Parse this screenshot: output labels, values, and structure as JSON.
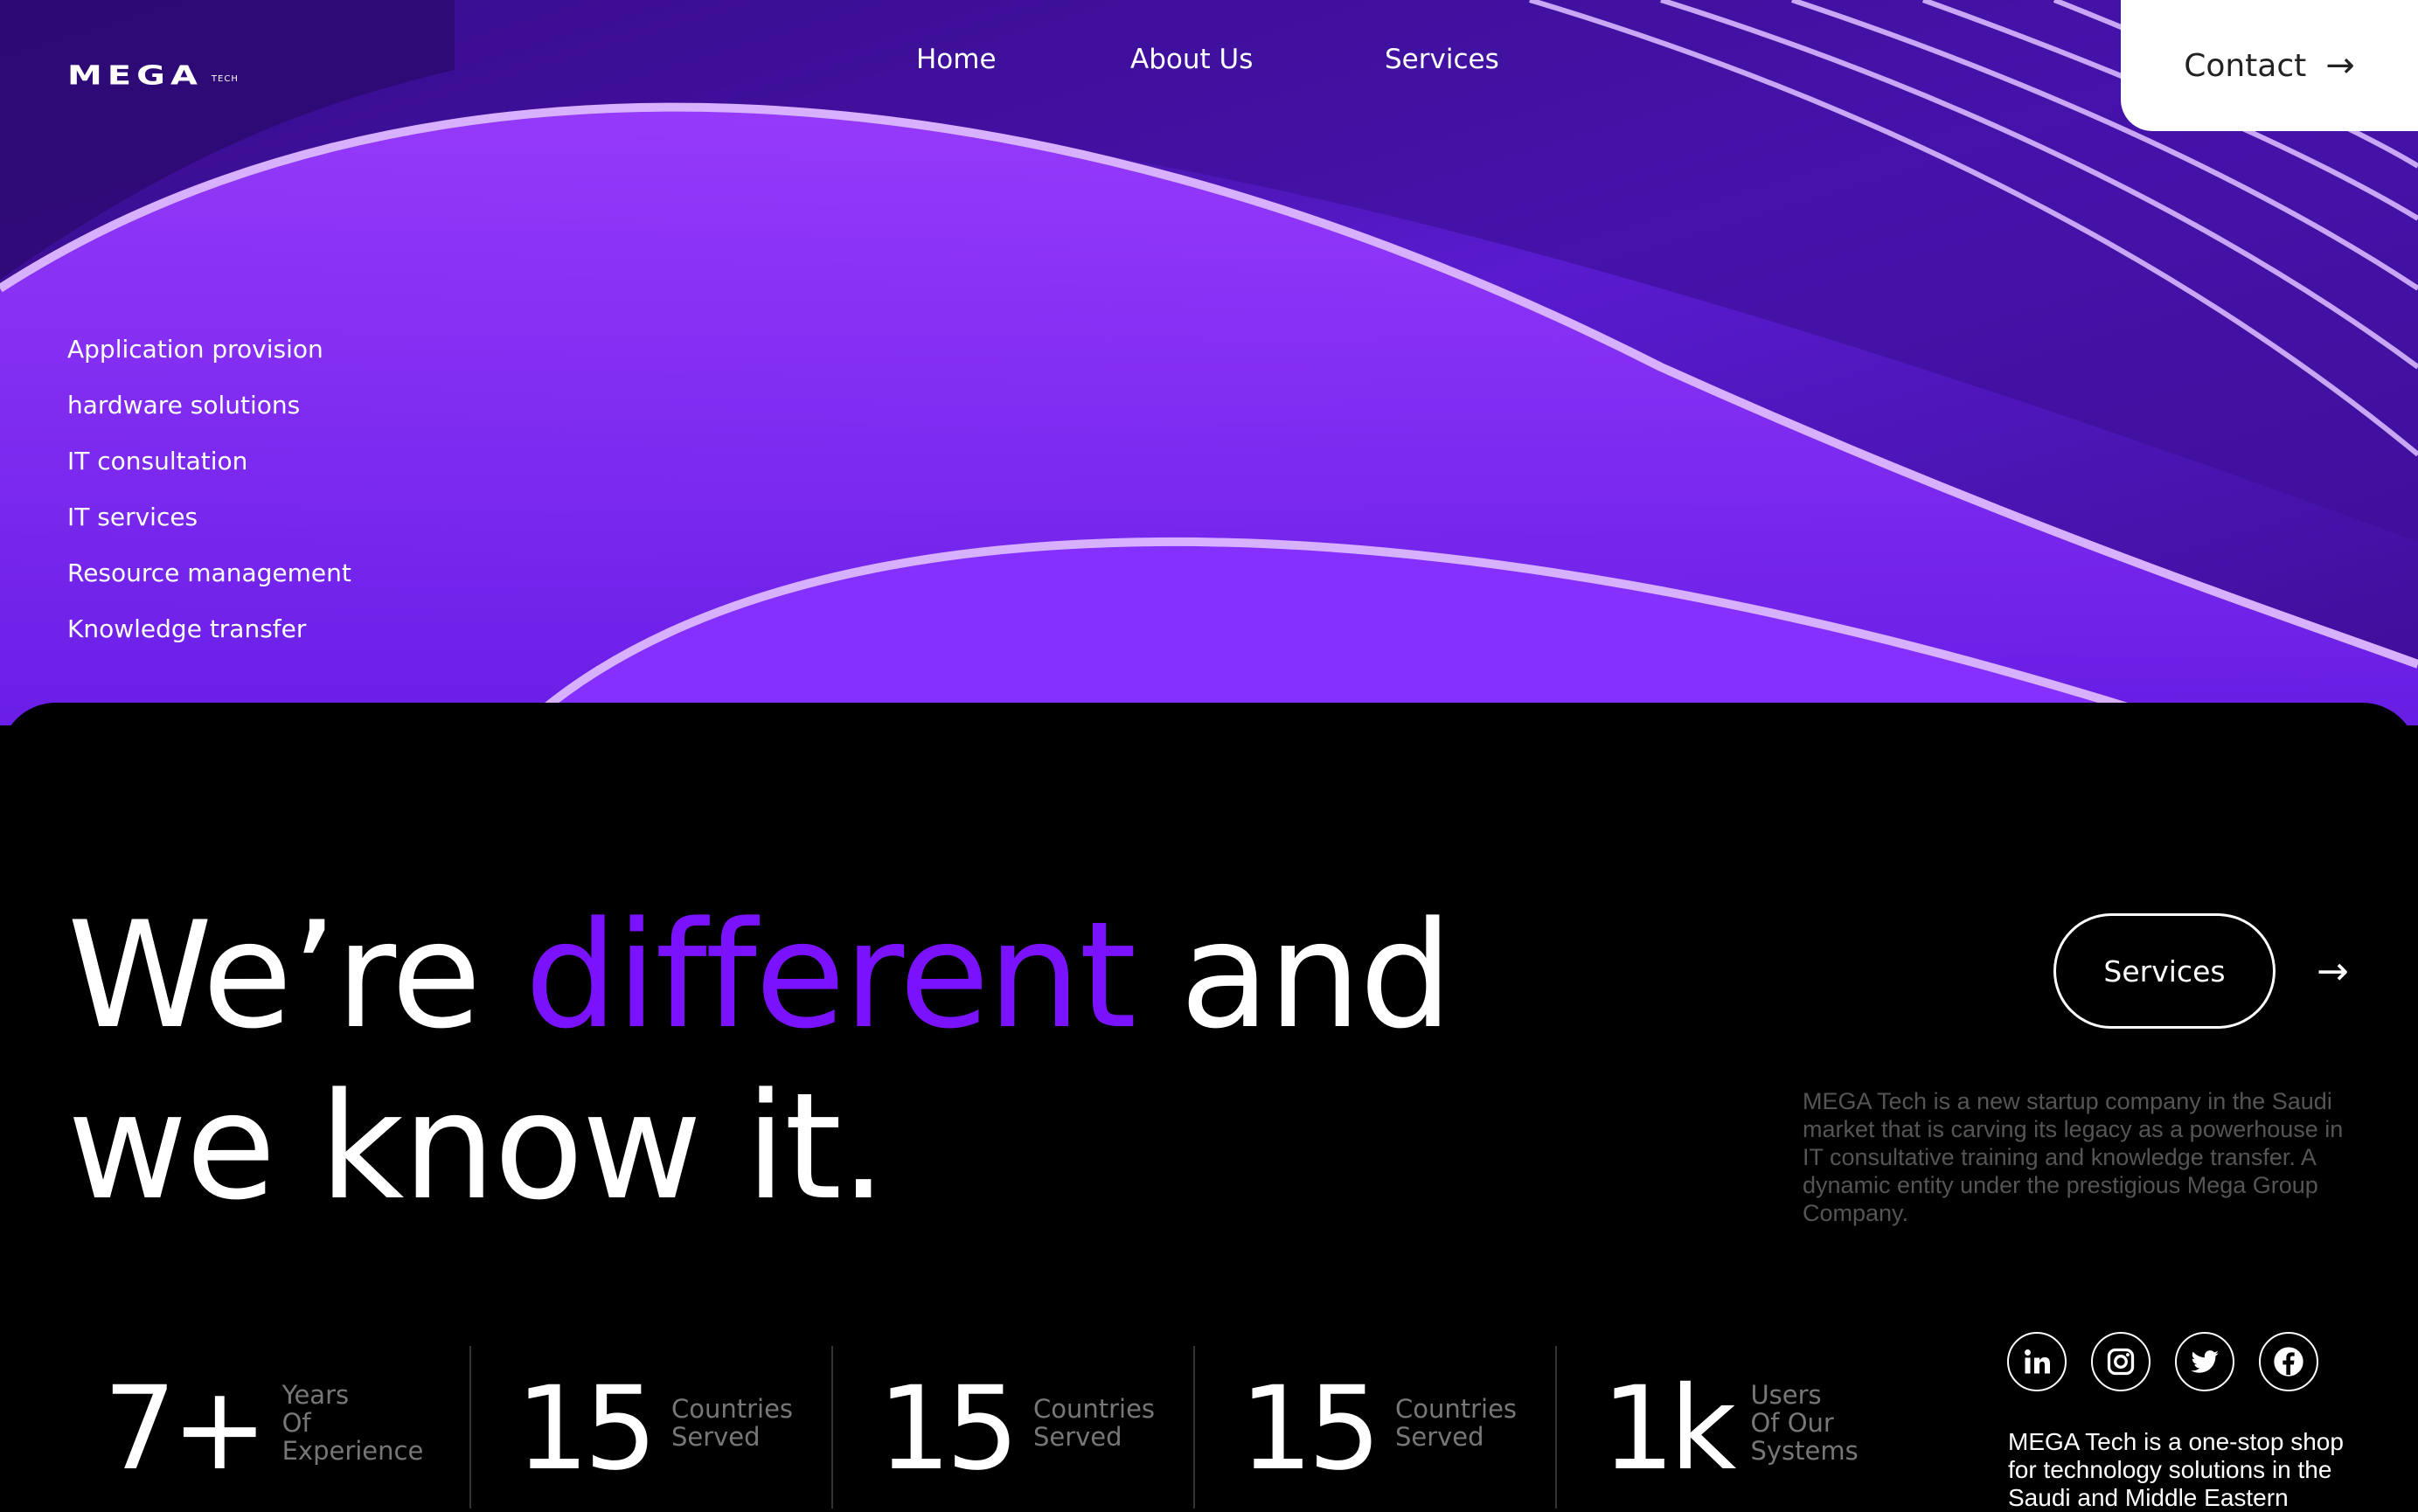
{
  "brand": {
    "name": "MEGA",
    "tag": "TECH"
  },
  "nav": {
    "home": "Home",
    "about": "About Us",
    "services": "Services"
  },
  "contact": {
    "label": "Contact",
    "arrow": "→"
  },
  "services_list": [
    "Application provision",
    "hardware solutions",
    "IT consultation",
    "IT services",
    "Resource management",
    "Knowledge transfer"
  ],
  "headline": {
    "part1": "We’re ",
    "accent": "different",
    "part2": " and",
    "line2": "we know it."
  },
  "cta": {
    "label": "Services",
    "arrow": "→"
  },
  "about_text": "MEGA Tech is a new startup company in the Saudi market that is carving its legacy as a powerhouse in IT consultative training and knowledge transfer. A dynamic entity under the prestigious Mega Group Company.",
  "stats": [
    {
      "value": "7+",
      "line1": "Years",
      "line2": "Of",
      "line3": "Experience"
    },
    {
      "value": "15",
      "line1": "Countries",
      "line2": "Served"
    },
    {
      "value": "15",
      "line1": "Countries",
      "line2": "Served"
    },
    {
      "value": "15",
      "line1": "Countries",
      "line2": "Served"
    },
    {
      "value": "1k",
      "line1": "Users",
      "line2": "Of Our",
      "line3": "Systems"
    }
  ],
  "socials": [
    "linkedin-icon",
    "instagram-icon",
    "twitter-icon",
    "facebook-icon"
  ],
  "social_text": "MEGA Tech is a one-stop shop for technology solutions in the Saudi and Middle Eastern",
  "colors": {
    "accent": "#7b12ff",
    "hero_purple": "#8a2eff",
    "background": "#000000"
  }
}
